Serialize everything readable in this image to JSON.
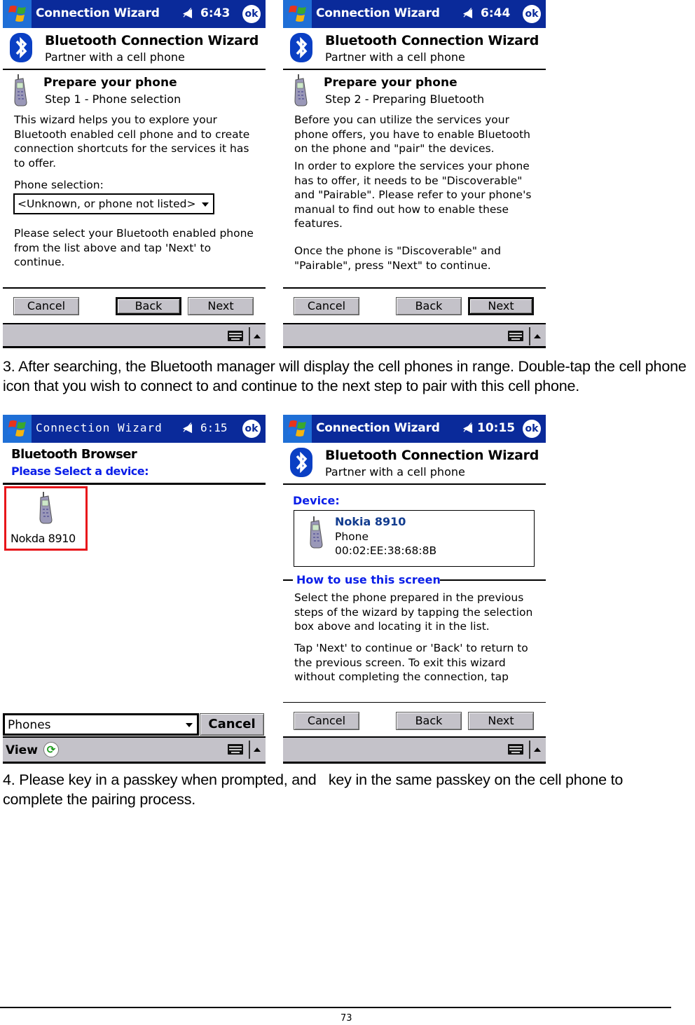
{
  "screens": [
    {
      "title_bar": {
        "app_title": "Connection Wizard",
        "time": "6:43",
        "ok_label": "ok",
        "icons": [
          "windows-start-icon",
          "speaker-icon"
        ]
      },
      "header": {
        "title": "Bluetooth Connection Wizard",
        "subtitle": "Partner with a cell phone",
        "icon": "bluetooth-icon"
      },
      "step": {
        "title": "Prepare your phone",
        "subtitle": "Step 1 - Phone selection",
        "icon": "cell-phone-icon"
      },
      "intro_text": "This wizard helps you to explore your Bluetooth enabled cell phone and to create connection shortcuts for the services it has to offer.",
      "phone_selection_label": "Phone selection:",
      "phone_selection_value": "<Unknown, or phone not listed>",
      "instruction_text": "Please select your Bluetooth enabled phone from the list above and tap 'Next' to continue.",
      "buttons": {
        "cancel": "Cancel",
        "back": "Back",
        "next": "Next",
        "default": "back"
      },
      "menu_bar": {
        "icons": [
          "keyboard-icon",
          "up-arrow-icon"
        ]
      }
    },
    {
      "title_bar": {
        "app_title": "Connection Wizard",
        "time": "6:44",
        "ok_label": "ok"
      },
      "header": {
        "title": "Bluetooth Connection Wizard",
        "subtitle": "Partner with a cell phone"
      },
      "step": {
        "title": "Prepare your phone",
        "subtitle": "Step 2 - Preparing Bluetooth"
      },
      "paragraph_1": "Before you can utilize the services your phone offers, you have to enable Bluetooth on the phone and \"pair\" the devices.",
      "paragraph_2": "In order to explore the services your phone has to offer, it needs to be \"Discoverable\" and \"Pairable\". Please refer to your phone's manual to find out how to enable these features.",
      "paragraph_3": "Once the phone is \"Discoverable\" and \"Pairable\", press \"Next\" to continue.",
      "buttons": {
        "cancel": "Cancel",
        "back": "Back",
        "next": "Next",
        "default": "next"
      }
    },
    {
      "title_bar": {
        "app_title": "Connection Wizard",
        "time": "6:15",
        "ok_label": "ok"
      },
      "header": {
        "title": "Bluetooth Browser",
        "subtitle": "Please Select a device:"
      },
      "devices": [
        {
          "name": "Nokia 8910",
          "label_shown": "Nokda 8910",
          "icon": "cell-phone-icon",
          "highlighted": true
        }
      ],
      "highlight_color": "#e8161b",
      "filter_value": "Phones",
      "cancel_label": "Cancel",
      "menu_bar": {
        "view_label": "View",
        "icons": [
          "refresh-icon",
          "keyboard-icon",
          "up-arrow-icon"
        ]
      }
    },
    {
      "title_bar": {
        "app_title": "Connection Wizard",
        "time": "10:15",
        "ok_label": "ok"
      },
      "header": {
        "title": "Bluetooth Connection Wizard",
        "subtitle": "Partner with a cell phone"
      },
      "device_label": "Device:",
      "device": {
        "name": "Nokia 8910",
        "type": "Phone",
        "address": "00:02:EE:38:68:8B"
      },
      "howto_title": "How to use this screen",
      "howto_p1": "Select the phone prepared in the previous steps of the wizard by tapping the selection box above and locating it in the list.",
      "howto_p2": "Tap 'Next' to continue or 'Back' to return to the previous screen. To exit this wizard without completing the connection, tap",
      "buttons": {
        "cancel": "Cancel",
        "back": "Back",
        "next": "Next"
      }
    }
  ],
  "document": {
    "step3_text": "3. After searching, the Bluetooth manager will display the cell phones in range. Double-tap the cell phone icon that you wish to connect to and continue to the next step to pair with this cell phone.",
    "step4_text": "4. Please key in a passkey when prompted, and   key in the same passkey on the cell phone to complete the pairing process.",
    "page_number": "73"
  },
  "colors": {
    "title_bar": "#0a2a9a",
    "start_button": "#1f6fd6",
    "button_face": "#c4c2c9",
    "link_blue": "#0a1ee8",
    "device_name_blue": "#123c8f"
  }
}
